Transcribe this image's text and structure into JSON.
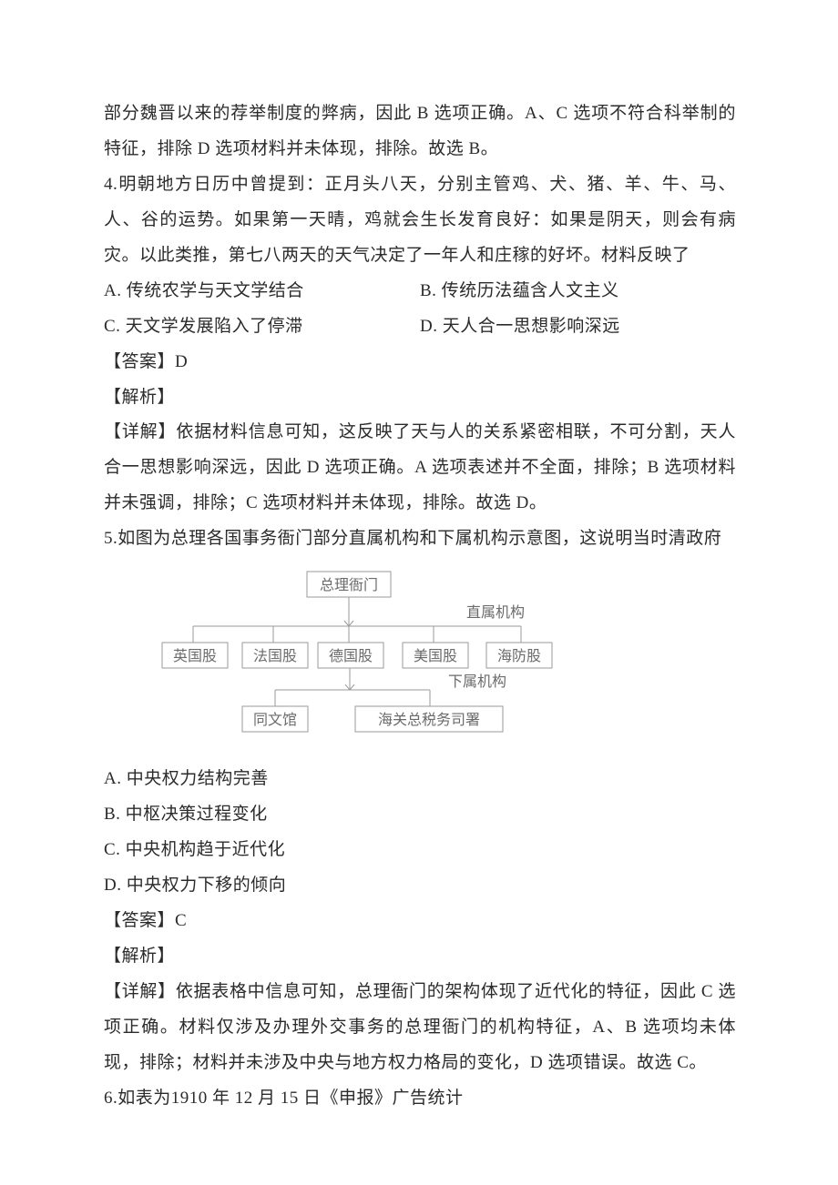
{
  "p_prev_cont": "部分魏晋以来的荐举制度的弊病，因此 B 选项正确。A、C 选项不符合科举制的特征，排除 D 选项材料并未体现，排除。故选 B。",
  "q4": {
    "stem": "4.明朝地方日历中曾提到：正月头八天，分别主管鸡、犬、猪、羊、牛、马、人、谷的运势。如果第一天晴，鸡就会生长发育良好：如果是阴天，则会有病灾。以此类推，第七八两天的天气决定了一年人和庄稼的好坏。材料反映了",
    "opts": {
      "a": "A. 传统农学与天文学结合",
      "b": "B. 传统历法蕴含人文主义",
      "c": "C. 天文学发展陷入了停滞",
      "d": "D. 天人合一思想影响深远"
    },
    "ans_label": "【答案】D",
    "jiexi_label": "【解析】",
    "detail": "【详解】依据材料信息可知，这反映了天与人的关系紧密相联，不可分割，天人合一思想影响深远，因此 D 选项正确。A 选项表述并不全面，排除；B 选项材料并未强调，排除；C 选项材料并未体现，排除。故选 D。"
  },
  "q5": {
    "stem": "5.如图为总理各国事务衙门部分直属机构和下属机构示意图，这说明当时清政府",
    "diagram": {
      "top": "总理衙门",
      "tag1": "直属机构",
      "row": [
        "英国股",
        "法国股",
        "德国股",
        "美国股",
        "海防股"
      ],
      "tag2": "下属机构",
      "bottom": [
        "同文馆",
        "海关总税务司署"
      ]
    },
    "opts": {
      "a": "A. 中央权力结构完善",
      "b": "B. 中枢决策过程变化",
      "c": "C. 中央机构趋于近代化",
      "d": "D. 中央权力下移的倾向"
    },
    "ans_label": "【答案】C",
    "jiexi_label": "【解析】",
    "detail": "【详解】依据表格中信息可知，总理衙门的架构体现了近代化的特征，因此 C 选项正确。材料仅涉及办理外交事务的总理衙门的机构特征，A、B 选项均未体现，排除；材料并未涉及中央与地方权力格局的变化，D 选项错误。故选 C。"
  },
  "q6": {
    "stem": "6.如表为1910 年 12 月 15 日《申报》广告统计"
  }
}
